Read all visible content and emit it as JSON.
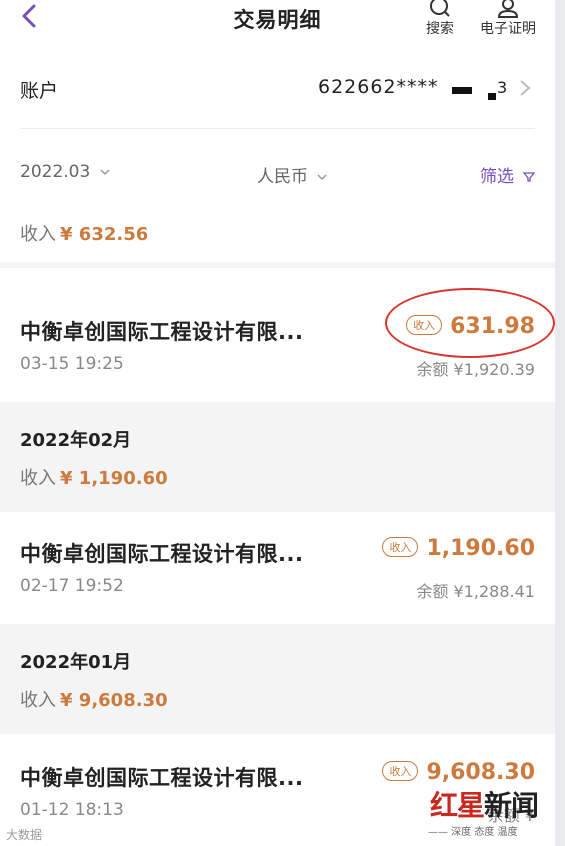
{
  "header": {
    "title": "交易明细",
    "search_label": "搜索",
    "certificate_label": "电子证明"
  },
  "account": {
    "label": "账户",
    "number": "622662****",
    "suffix": "3"
  },
  "filters": {
    "date": "2022.03",
    "currency": "人民币",
    "screen": "筛选"
  },
  "march": {
    "income_label": "收入",
    "income_amount": "¥ 632.56"
  },
  "transactions": [
    {
      "name": "中衡卓创国际工程设计有限...",
      "time": "03-15 19:25",
      "badge": "收入",
      "amount": "631.98",
      "balance": "余额 ¥1,920.39"
    },
    {
      "name": "中衡卓创国际工程设计有限...",
      "time": "02-17 19:52",
      "badge": "收入",
      "amount": "1,190.60",
      "balance": "余额 ¥1,288.41"
    },
    {
      "name": "中衡卓创国际工程设计有限...",
      "time": "01-12 18:13",
      "badge": "收入",
      "amount": "9,608.30",
      "balance": "余额 ¥"
    }
  ],
  "months": [
    {
      "title": "2022年02月",
      "income_label": "收入",
      "income_amount": "¥ 1,190.60"
    },
    {
      "title": "2022年01月",
      "income_label": "收入",
      "income_amount": "¥ 9,608.30"
    }
  ],
  "watermarks": {
    "left": "大数据",
    "logo_a": "红",
    "logo_b": "星",
    "logo_c": "新闻",
    "sub": "—— 深度 态度 温度"
  },
  "colors": {
    "accent_purple": "#7b4dbf",
    "income_orange": "#cc7a3e",
    "highlight_red": "#d9342b"
  },
  "icons": [
    "chevron-left-icon",
    "search-icon",
    "person-certificate-icon",
    "chevron-right-icon",
    "chevron-down-icon",
    "filter-icon"
  ]
}
